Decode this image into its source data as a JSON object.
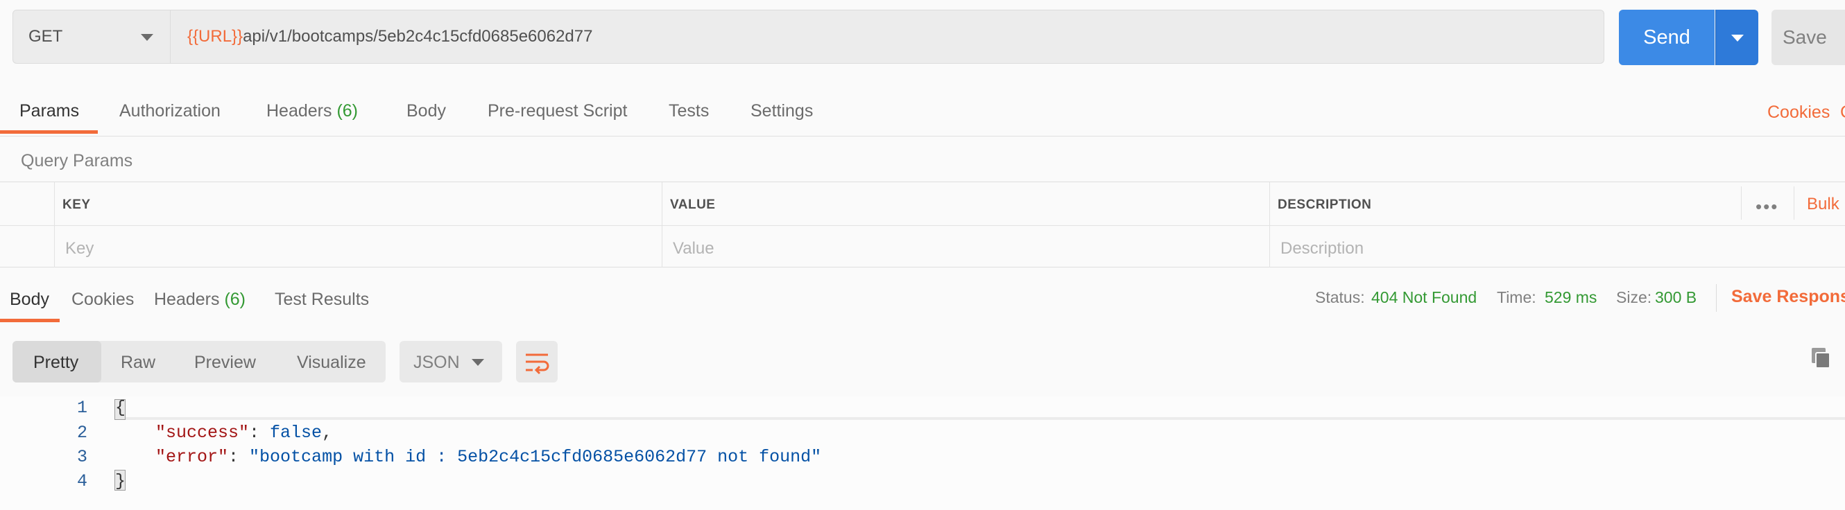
{
  "request": {
    "method": "GET",
    "url_variable": "{{URL}}",
    "url_path": "api/v1/bootcamps/5eb2c4c15cfd0685e6062d77",
    "send_label": "Send",
    "save_label": "Save"
  },
  "request_tabs": {
    "params": "Params",
    "authorization": "Authorization",
    "headers": "Headers",
    "headers_count": "(6)",
    "body": "Body",
    "prerequest": "Pre-request Script",
    "tests": "Tests",
    "settings": "Settings",
    "cookies": "Cookies",
    "cookies_trail": "C"
  },
  "query_params": {
    "title": "Query Params",
    "columns": [
      "KEY",
      "VALUE",
      "DESCRIPTION"
    ],
    "placeholders": [
      "Key",
      "Value",
      "Description"
    ],
    "more": "•••",
    "bulk": "Bulk"
  },
  "response_tabs": {
    "body": "Body",
    "cookies": "Cookies",
    "headers": "Headers",
    "headers_count": "(6)",
    "test_results": "Test Results"
  },
  "response_meta": {
    "status_label": "Status:",
    "status_value": "404 Not Found",
    "time_label": "Time:",
    "time_value": "529 ms",
    "size_label": "Size:",
    "size_value": "300 B",
    "save_response": "Save Response"
  },
  "view": {
    "pretty": "Pretty",
    "raw": "Raw",
    "preview": "Preview",
    "visualize": "Visualize",
    "format": "JSON"
  },
  "code": {
    "line_numbers": [
      "1",
      "2",
      "3",
      "4"
    ],
    "open_brace": "{",
    "success_key": "\"success\"",
    "success_value": "false",
    "error_key": "\"error\"",
    "error_value": "\"bootcamp with id : 5eb2c4c15cfd0685e6062d77 not found\"",
    "close_brace": "}"
  },
  "colors": {
    "accent": "#f26b3a",
    "send_blue": "#3c8ae6",
    "status_green": "#339933"
  }
}
